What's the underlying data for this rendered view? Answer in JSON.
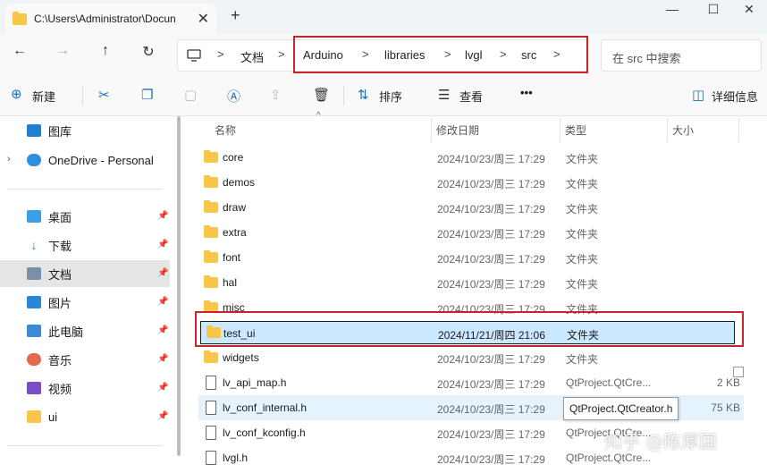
{
  "window": {
    "tab_title": "C:\\Users\\Administrator\\Docun",
    "new_tab": "+",
    "minimize": "—",
    "maximize": "☐",
    "close": "✕",
    "tab_close": "✕"
  },
  "nav": {
    "back": "←",
    "forward": "→",
    "up": "↑",
    "refresh": "↻"
  },
  "address": {
    "root_icon": "computer-icon",
    "items": [
      "文档",
      "Arduino",
      "libraries",
      "lvgl",
      "src"
    ],
    "separator": ">"
  },
  "search": {
    "placeholder": "在 src 中搜索"
  },
  "toolbar": {
    "new_label": "新建",
    "sort_label": "排序",
    "view_label": "查看",
    "more": "•••",
    "details_label": "详细信息"
  },
  "sidebar": {
    "items": [
      {
        "label": "图库",
        "icon": "gallery-icon"
      },
      {
        "label": "OneDrive - Personal",
        "icon": "onedrive-icon"
      },
      {
        "label": "桌面",
        "icon": "desktop-icon"
      },
      {
        "label": "下载",
        "icon": "download-icon"
      },
      {
        "label": "文档",
        "icon": "documents-icon"
      },
      {
        "label": "图片",
        "icon": "pictures-icon"
      },
      {
        "label": "此电脑",
        "icon": "this-pc-icon"
      },
      {
        "label": "音乐",
        "icon": "music-icon"
      },
      {
        "label": "视频",
        "icon": "videos-icon"
      },
      {
        "label": "ui",
        "icon": "folder-icon"
      }
    ]
  },
  "columns": {
    "name": "名称",
    "date": "修改日期",
    "type": "类型",
    "size": "大小"
  },
  "files": [
    {
      "name": "core",
      "date": "2024/10/23/周三 17:29",
      "type": "文件夹",
      "size": ""
    },
    {
      "name": "demos",
      "date": "2024/10/23/周三 17:29",
      "type": "文件夹",
      "size": ""
    },
    {
      "name": "draw",
      "date": "2024/10/23/周三 17:29",
      "type": "文件夹",
      "size": ""
    },
    {
      "name": "extra",
      "date": "2024/10/23/周三 17:29",
      "type": "文件夹",
      "size": ""
    },
    {
      "name": "font",
      "date": "2024/10/23/周三 17:29",
      "type": "文件夹",
      "size": ""
    },
    {
      "name": "hal",
      "date": "2024/10/23/周三 17:29",
      "type": "文件夹",
      "size": ""
    },
    {
      "name": "misc",
      "date": "2024/10/23/周三 17:29",
      "type": "文件夹",
      "size": ""
    },
    {
      "name": "test_ui",
      "date": "2024/11/21/周四 21:06",
      "type": "文件夹",
      "size": ""
    },
    {
      "name": "widgets",
      "date": "2024/10/23/周三 17:29",
      "type": "文件夹",
      "size": ""
    },
    {
      "name": "lv_api_map.h",
      "date": "2024/10/23/周三 17:29",
      "type": "QtProject.QtCre...",
      "size": "2 KB"
    },
    {
      "name": "lv_conf_internal.h",
      "date": "2024/10/23/周三 17:29",
      "type": "QtProject.QtCreator.h",
      "size": "75 KB"
    },
    {
      "name": "lv_conf_kconfig.h",
      "date": "2024/10/23/周三 17:29",
      "type": "QtProject.QtCre...",
      "size": ""
    },
    {
      "name": "lvgl.h",
      "date": "2024/10/23/周三 17:29",
      "type": "QtProject.QtCre...",
      "size": ""
    }
  ],
  "tooltip": "QtProject.QtCreator.h",
  "watermark": "知乎 @陈厚国"
}
